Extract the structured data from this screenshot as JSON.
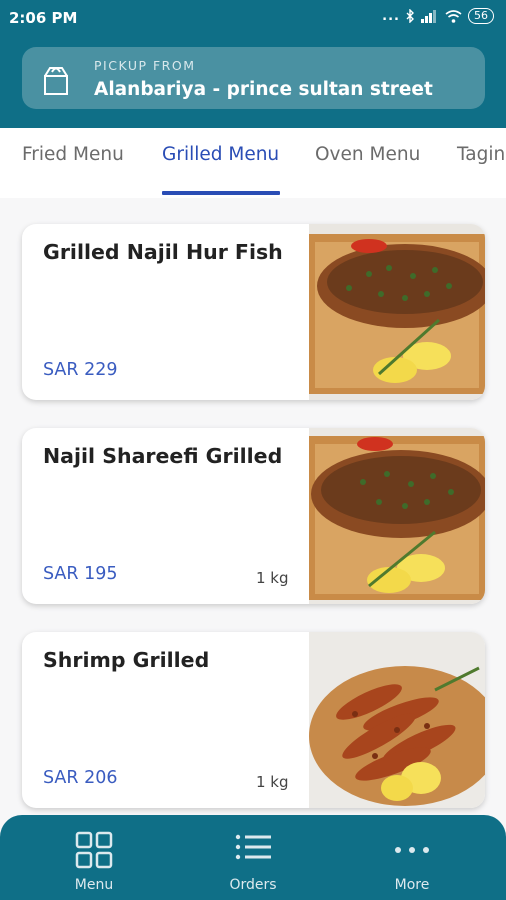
{
  "status_bar": {
    "time": "2:06 PM",
    "dots": "...",
    "battery": "56"
  },
  "pickup": {
    "caption": "PICKUP FROM",
    "location": "Alanbariya - prince sultan street"
  },
  "tabs": [
    {
      "label": "Fried Menu",
      "active": false
    },
    {
      "label": "Grilled Menu",
      "active": true
    },
    {
      "label": "Oven Menu",
      "active": false
    },
    {
      "label": "Tagine",
      "active": false
    }
  ],
  "menu_items": [
    {
      "name": "Grilled Najil Hur Fish",
      "price": "SAR 229",
      "weight": "",
      "image": "grilled-fish-photo"
    },
    {
      "name": "Najil Shareefi Grilled",
      "price": "SAR 195",
      "weight": "1 kg",
      "image": "grilled-fish-photo"
    },
    {
      "name": "Shrimp Grilled",
      "price": "SAR 206",
      "weight": "1 kg",
      "image": "grilled-shrimp-photo"
    }
  ],
  "bottom_nav": [
    {
      "label": "Menu",
      "icon": "grid-icon"
    },
    {
      "label": "Orders",
      "icon": "list-icon"
    },
    {
      "label": "More",
      "icon": "more-dots-icon"
    }
  ],
  "colors": {
    "primary": "#0f6f87",
    "accent": "#2a4db5",
    "price": "#3a5cc0"
  }
}
